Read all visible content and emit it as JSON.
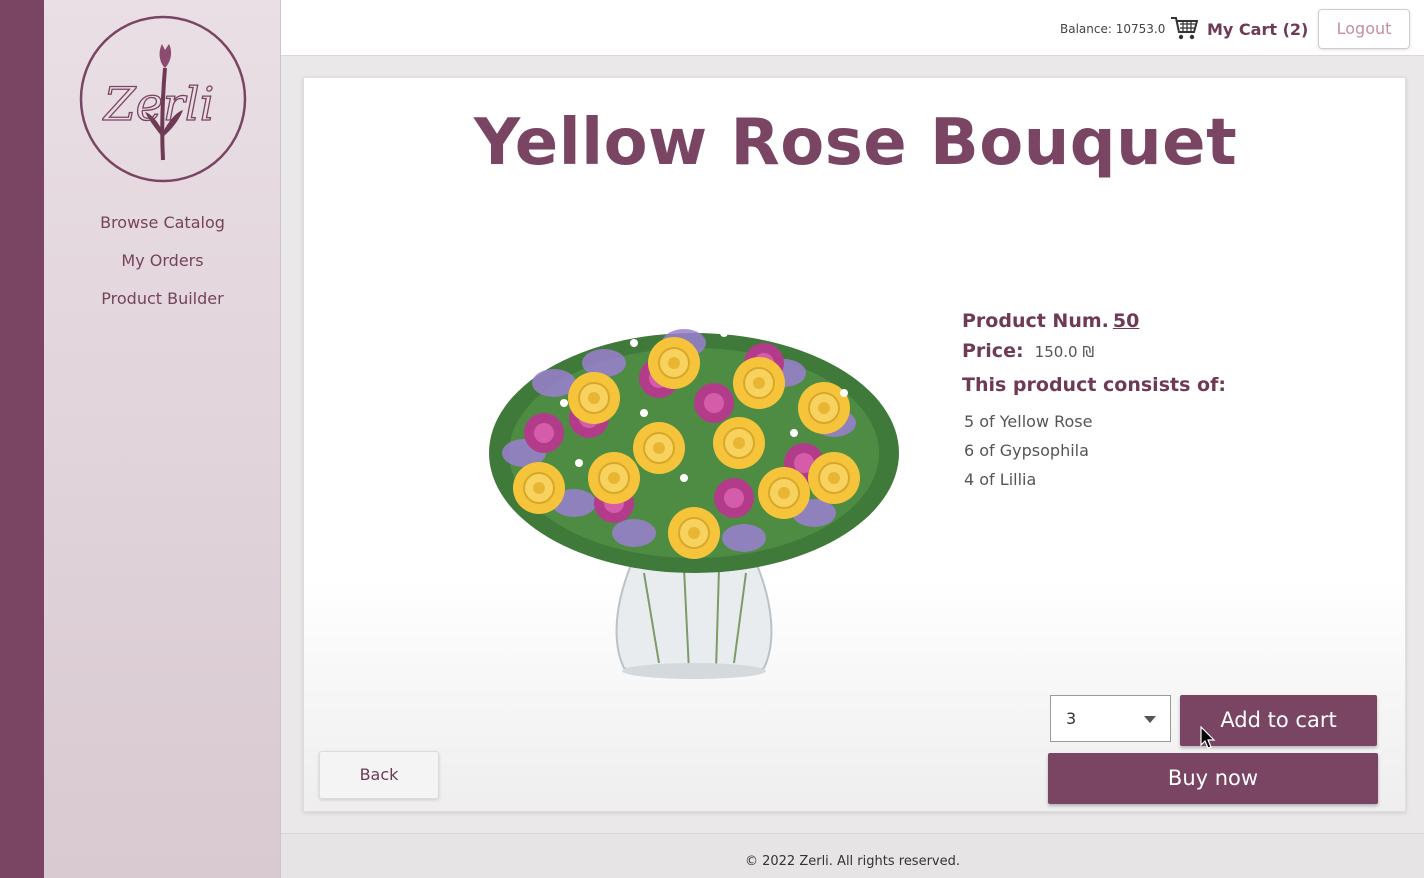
{
  "sidebar": {
    "logo_text": "Zerli",
    "nav": [
      "Browse Catalog",
      "My Orders",
      "Product Builder"
    ]
  },
  "header": {
    "balance": "Balance: 10753.0",
    "cart_label": "My Cart (2)",
    "logout_label": "Logout"
  },
  "product": {
    "title": "Yellow Rose Bouquet",
    "num_label": "Product Num.",
    "num_value": "50",
    "price_label": "Price:",
    "price_value": "150.0 ₪",
    "consists_label": "This product consists of:",
    "components": [
      "5 of Yellow Rose",
      "6 of Gypsophila",
      "4 of Lillia"
    ]
  },
  "actions": {
    "quantity": "3",
    "add_to_cart": "Add to cart",
    "buy_now": "Buy now",
    "back": "Back"
  },
  "footer": {
    "text": "© 2022 Zerli. All rights reserved."
  },
  "colors": {
    "brand": "#7a4463",
    "sidebar_bg": "#e9dfe4",
    "rose": "#f5c43a",
    "carnation": "#b23c8a",
    "statice": "#9b7fd0"
  },
  "icons": {
    "cart": "shopping-cart-icon",
    "logo": "tulip-logo-icon",
    "dropdown": "chevron-down-icon",
    "cursor": "mouse-pointer-icon"
  }
}
